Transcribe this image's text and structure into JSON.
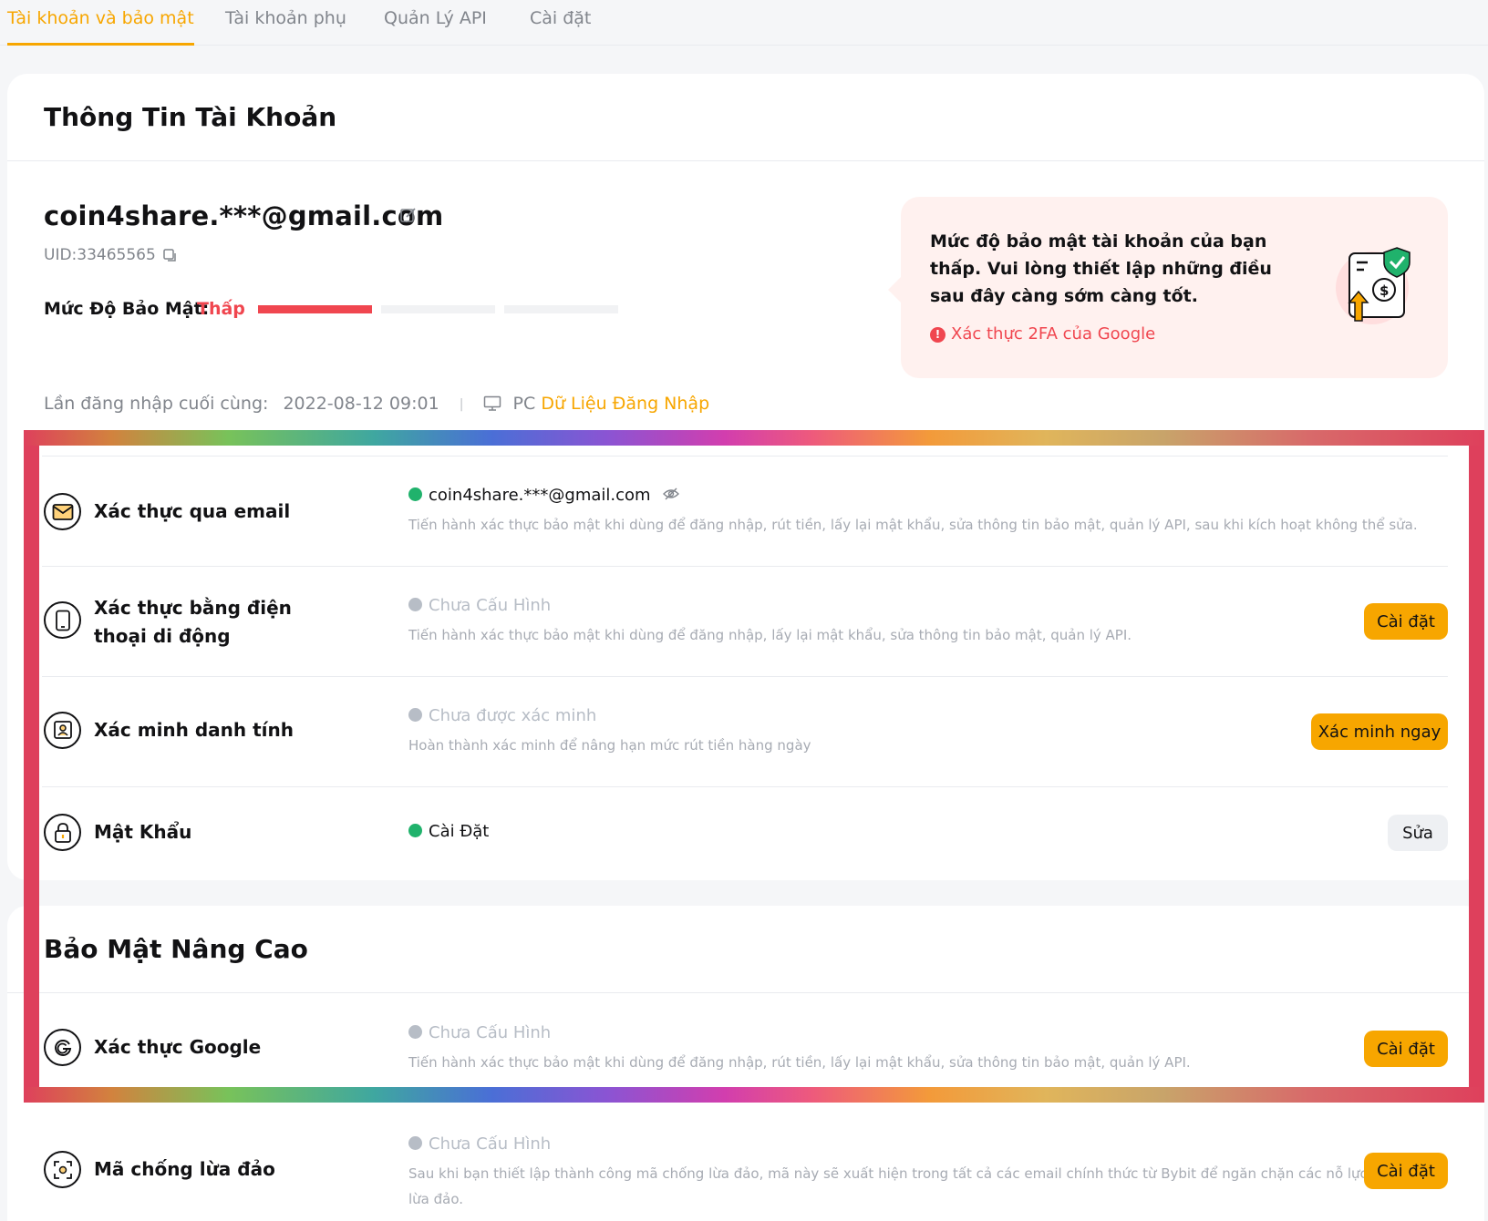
{
  "tabs": [
    {
      "label": "Tài khoản và bảo mật",
      "active": true
    },
    {
      "label": "Tài khoản phụ",
      "active": false
    },
    {
      "label": "Quản Lý API",
      "active": false
    },
    {
      "label": "Cài đặt",
      "active": false
    }
  ],
  "account_info": {
    "title": "Thông Tin Tài Khoản",
    "email": "coin4share.***@gmail.com",
    "uid": "UID:33465565",
    "security_level_label": "Mức Độ Bảo Mật:",
    "security_level_value": "Thấp",
    "last_login_label": "Lần đăng nhập cuối cùng:",
    "last_login_time": "2022-08-12 09:01",
    "device": "PC",
    "login_data_link": "Dữ Liệu Đăng Nhập"
  },
  "alert": {
    "text": "Mức độ bảo mật tài khoản của bạn thấp. Vui lòng thiết lập những điều sau đây càng sớm càng tốt.",
    "item": "Xác thực 2FA của Google"
  },
  "basic_rows": [
    {
      "label": "Xác thực qua email",
      "status": "coin4share.***@gmail.com",
      "desc": "Tiến hành xác thực bảo mật khi dùng để đăng nhập, rút tiền, lấy lại mật khẩu, sửa thông tin bảo mật, quản lý API, sau khi kích hoạt không thể sửa."
    },
    {
      "label": "Xác thực bằng điện thoại di động",
      "status": "Chưa Cấu Hình",
      "desc": "Tiến hành xác thực bảo mật khi dùng để đăng nhập, lấy lại mật khẩu, sửa thông tin bảo mật, quản lý API.",
      "button": "Cài đặt"
    },
    {
      "label": "Xác minh danh tính",
      "status": "Chưa được xác minh",
      "desc": "Hoàn thành xác minh để nâng hạn mức rút tiền hàng ngày",
      "button": "Xác minh ngay"
    },
    {
      "label": "Mật Khẩu",
      "status": "Cài Đặt",
      "button": "Sửa"
    }
  ],
  "advanced": {
    "title": "Bảo Mật Nâng Cao",
    "rows": [
      {
        "label": "Xác thực Google",
        "status": "Chưa Cấu Hình",
        "desc": "Tiến hành xác thực bảo mật khi dùng để đăng nhập, rút tiền, lấy lại mật khẩu, sửa thông tin bảo mật, quản lý API.",
        "button": "Cài đặt"
      },
      {
        "label": "Mã chống lừa đảo",
        "status": "Chưa Cấu Hình",
        "desc_line1": "Sau khi bạn thiết lập thành công mã chống lừa đảo, mã này sẽ xuất hiện trong tất cả các email chính thức từ Bybit để ngăn chặn các nỗ lực",
        "desc_line2": "lừa đảo.",
        "button": "Cài đặt"
      }
    ]
  },
  "colors": {
    "accent": "#f7a600",
    "danger": "#f0464f",
    "success": "#20b26c"
  }
}
